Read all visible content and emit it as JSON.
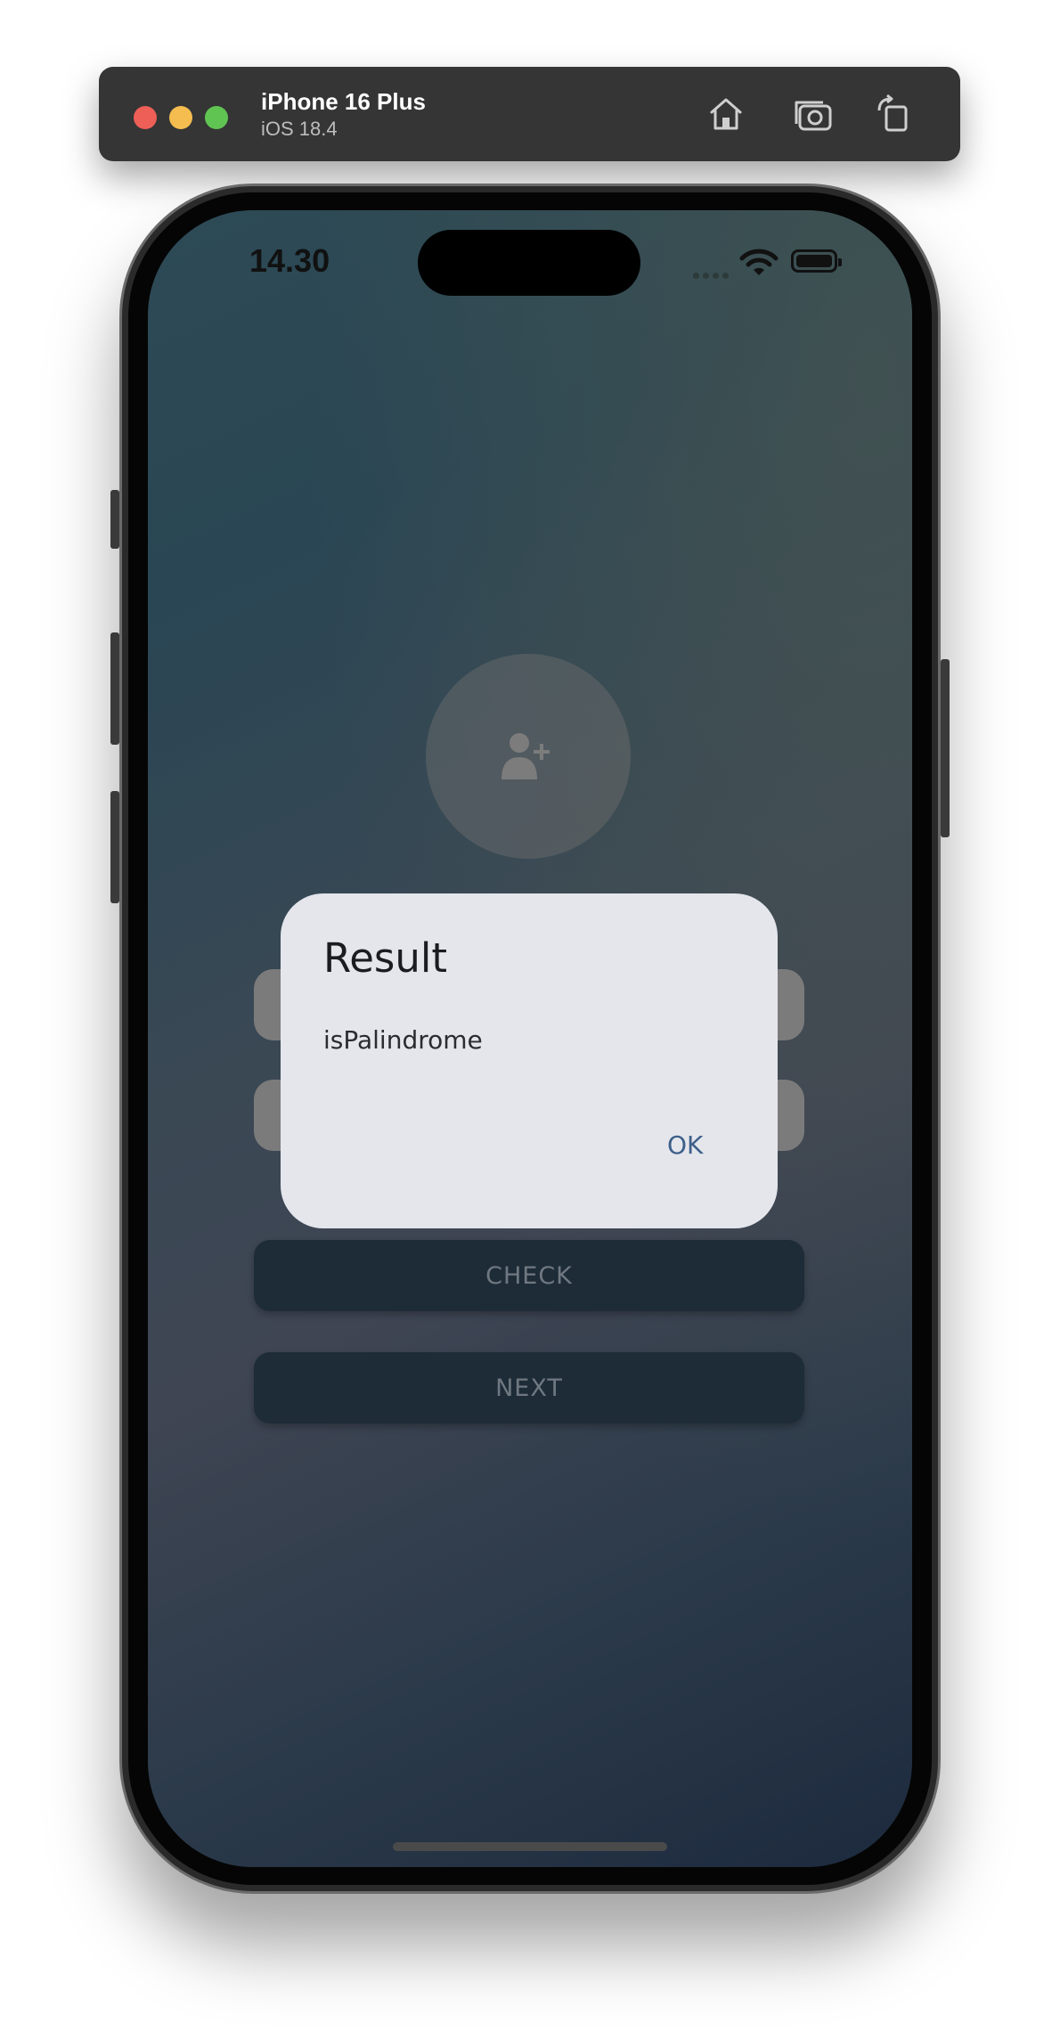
{
  "simulator": {
    "device_name": "iPhone 16 Plus",
    "os_version": "iOS 18.4",
    "toolbar_icons": [
      "home-icon",
      "screenshot-icon",
      "rotate-icon"
    ]
  },
  "status_bar": {
    "time": "14.30",
    "icons": [
      "cellular-signal-icon",
      "wifi-icon",
      "battery-icon"
    ]
  },
  "app": {
    "avatar_icon": "add-user-icon",
    "check_button": "CHECK",
    "next_button": "NEXT"
  },
  "dialog": {
    "title": "Result",
    "message": "isPalindrome",
    "ok_button": "OK"
  },
  "colors": {
    "dialog_background": "#e4e6ec",
    "dialog_action": "#3e5f8a",
    "button_background": "#1e2c38"
  }
}
